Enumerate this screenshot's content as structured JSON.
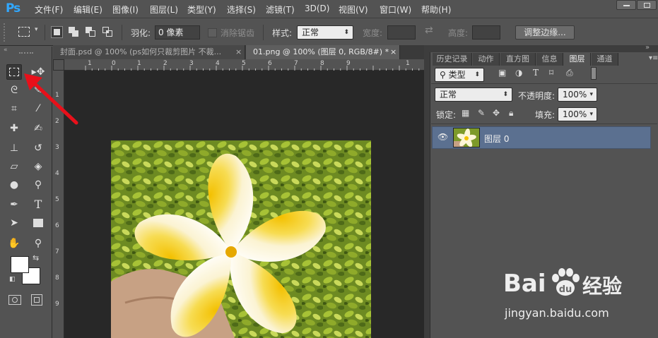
{
  "app": {
    "logo": "Ps"
  },
  "menu": [
    "文件(F)",
    "编辑(E)",
    "图像(I)",
    "图层(L)",
    "类型(Y)",
    "选择(S)",
    "滤镜(T)",
    "3D(D)",
    "视图(V)",
    "窗口(W)",
    "帮助(H)"
  ],
  "options": {
    "feather_label": "羽化:",
    "feather_value": "0 像素",
    "antialias_label": "消除锯齿",
    "style_label": "样式:",
    "style_value": "正常",
    "width_label": "宽度:",
    "height_label": "高度:",
    "refine_edge_button": "调整边缘..."
  },
  "tabs": [
    {
      "label": "封面.psd @ 100% (ps如何只裁剪图片 不裁...",
      "close": "×"
    },
    {
      "label": "01.png @ 100% (图层 0, RGB/8#) *",
      "close": "×"
    }
  ],
  "ruler": {
    "h": [
      "1",
      "0",
      "1",
      "2",
      "3",
      "4",
      "5",
      "6",
      "7",
      "8",
      "9",
      "1"
    ],
    "v": [
      "1",
      "2",
      "3",
      "4",
      "5",
      "6",
      "7",
      "8",
      "9"
    ]
  },
  "panel_tabs": [
    "历史记录",
    "动作",
    "直方图",
    "信息",
    "图层",
    "通道"
  ],
  "layers_panel": {
    "filter_kind": "类型",
    "blend_mode": "正常",
    "opacity_label": "不透明度:",
    "opacity_value": "100%",
    "lock_label": "锁定:",
    "fill_label": "填充:",
    "fill_value": "100%",
    "layers": [
      {
        "name": "图层 0",
        "visible": true
      }
    ]
  },
  "watermark": {
    "brand_text": "Bai",
    "brand_suffix": "经验",
    "url": "jingyan.baidu.com"
  },
  "colors": {
    "accent": "#31a8ff",
    "annotation_arrow": "#e8101a",
    "layer_selected": "#5b7090"
  }
}
